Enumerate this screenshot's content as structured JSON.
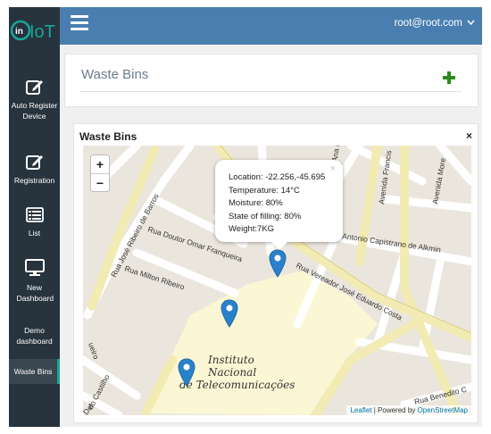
{
  "app": {
    "logo_text": "IoT",
    "logo_prefix": "in"
  },
  "sidebar": {
    "items": [
      {
        "label": "Auto Register Device",
        "icon": "edit-icon"
      },
      {
        "label": "Registration",
        "icon": "edit-icon"
      },
      {
        "label": "List",
        "icon": "list-icon"
      },
      {
        "label": "New Dashboard",
        "icon": "monitor-icon"
      },
      {
        "label": "Demo dashboard",
        "icon": ""
      },
      {
        "label": "Waste Bins",
        "icon": "",
        "active": true
      }
    ]
  },
  "topbar": {
    "user": "root@root.com"
  },
  "main": {
    "header_title": "Waste Bins",
    "map_panel_title": "Waste  Bins",
    "close_label": "×"
  },
  "map": {
    "zoom_in": "+",
    "zoom_out": "−",
    "popup": {
      "close": "×",
      "lines": [
        "Location: -22.256,-45.695",
        "Temperature: 14°C",
        "Moisture: 80%",
        "State of filling: 80%",
        "Weight:7KG"
      ]
    },
    "streets": [
      "Rua José Ribeiro de Barros",
      "Rua Doutor Omar Franqueira",
      "Rua Milton Ribeiro",
      "Rua Vereador José Eduardo Costa",
      "Antonio Capistrano de Alkmin",
      "Avenida Francis",
      "Avenida More",
      "Rua Ana Marques",
      "do Castilho",
      "ueiro",
      "Del",
      "Rua Benedito C"
    ],
    "place_label": [
      "Instituto",
      "Nacional",
      "de Telecomunicações"
    ],
    "attribution": {
      "leaflet": "Leaflet",
      "separator": " | Powered by ",
      "osm": "OpenStreetMap"
    },
    "marker_color": "#2a81cb"
  }
}
